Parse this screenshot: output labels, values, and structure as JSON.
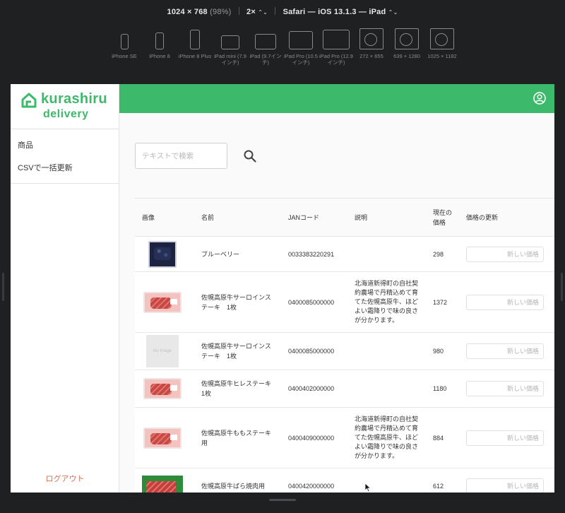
{
  "simulator": {
    "resolution": "1024 × 768",
    "zoom": "(98%)",
    "scale": "2×",
    "scale_chevron": "⌃⌄",
    "device_label": "Safari — iOS 13.1.3 — iPad",
    "device_chevron": "⌃⌄",
    "devices": [
      {
        "label": "iPhone SE",
        "kind": "phone-small"
      },
      {
        "label": "iPhone 8",
        "kind": "phone"
      },
      {
        "label": "iPhone 8 Plus",
        "kind": "phone-large"
      },
      {
        "label": "iPad mini (7.9インチ)",
        "kind": "tablet-small"
      },
      {
        "label": "iPad (9.7インチ)",
        "kind": "tablet"
      },
      {
        "label": "iPad Pro (10.5インチ)",
        "kind": "tablet-pro"
      },
      {
        "label": "iPad Pro (12.9インチ)",
        "kind": "tablet-pro-large"
      },
      {
        "label": "272 × 655",
        "kind": "custom"
      },
      {
        "label": "639 × 1280",
        "kind": "custom"
      },
      {
        "label": "1025 × 1182",
        "kind": "custom"
      }
    ]
  },
  "app": {
    "logo": {
      "name": "kurashiru",
      "sub": "delivery"
    },
    "brand_color": "#3cb96a",
    "nav": [
      {
        "label": "商品"
      },
      {
        "label": "CSVで一括更新"
      }
    ],
    "logout_label": "ログアウト",
    "search": {
      "placeholder": "テキストで検索",
      "value": ""
    },
    "table": {
      "headers": {
        "image": "画像",
        "name": "名前",
        "jan": "JANコード",
        "description": "説明",
        "price": "現在の価格",
        "update": "価格の更新"
      },
      "price_input_placeholder": "新しい価格",
      "rows": [
        {
          "thumb": "blueberry",
          "name": "ブルーベリー",
          "jan": "0033383220291",
          "description": "",
          "price": "298"
        },
        {
          "thumb": "meat",
          "name": "佐幌高原牛サーロインステーキ　1枚",
          "jan": "0400085000000",
          "description": "北海道新得町の自社契約農場で丹精込めて育てた佐幌高原牛、ほどよい霜降りで味の良さが分かります。",
          "price": "1372"
        },
        {
          "thumb": "noimage",
          "thumb_text": "No Image",
          "name": "佐幌高原牛サーロインステーキ　1枚",
          "jan": "0400085000000",
          "description": "",
          "price": "980"
        },
        {
          "thumb": "meat",
          "name": "佐幌高原牛ヒレステーキ 1枚",
          "jan": "0400402000000",
          "description": "",
          "price": "1180"
        },
        {
          "thumb": "meat",
          "name": "佐幌高原牛ももステーキ用",
          "jan": "0400409000000",
          "description": "北海道新得町の自社契約農場で丹精込めて育てた佐幌高原牛、ほどよい霜降りで味の良さが分かります。",
          "price": "884"
        },
        {
          "thumb": "green",
          "name": "佐幌高原牛ばら焼肉用",
          "jan": "0400420000000",
          "description": "",
          "price": "612"
        }
      ]
    }
  }
}
